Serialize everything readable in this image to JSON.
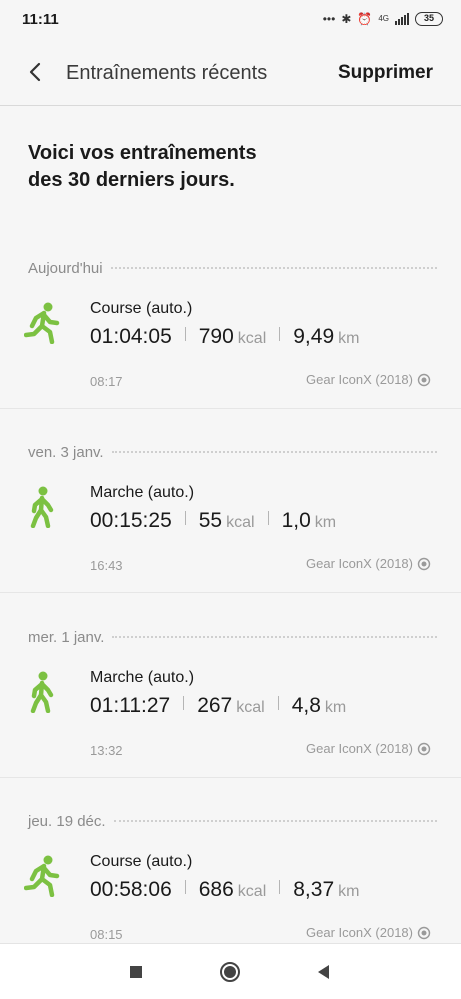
{
  "status": {
    "time": "11:11",
    "net": "4G",
    "battery": "35"
  },
  "header": {
    "title": "Entraînements récents",
    "action": "Supprimer"
  },
  "intro": "Voici vos entraînements\ndes 30 derniers jours.",
  "days": [
    {
      "label": "Aujourd'hui",
      "workout": {
        "type": "run",
        "name": "Course (auto.)",
        "duration": "01:04:05",
        "kcal": "790",
        "kcal_unit": "kcal",
        "distance": "9,49",
        "dist_unit": "km",
        "start": "08:17",
        "device": "Gear IconX (2018)"
      }
    },
    {
      "label": "ven. 3 janv.",
      "workout": {
        "type": "walk",
        "name": "Marche (auto.)",
        "duration": "00:15:25",
        "kcal": "55",
        "kcal_unit": "kcal",
        "distance": "1,0",
        "dist_unit": "km",
        "start": "16:43",
        "device": "Gear IconX (2018)"
      }
    },
    {
      "label": "mer. 1 janv.",
      "workout": {
        "type": "walk",
        "name": "Marche (auto.)",
        "duration": "01:11:27",
        "kcal": "267",
        "kcal_unit": "kcal",
        "distance": "4,8",
        "dist_unit": "km",
        "start": "13:32",
        "device": "Gear IconX (2018)"
      }
    },
    {
      "label": "jeu. 19 déc.",
      "workout": {
        "type": "run",
        "name": "Course (auto.)",
        "duration": "00:58:06",
        "kcal": "686",
        "kcal_unit": "kcal",
        "distance": "8,37",
        "dist_unit": "km",
        "start": "08:15",
        "device": "Gear IconX (2018)"
      }
    }
  ],
  "colors": {
    "accent_green": "#7cc142",
    "background": "#f6f6f6"
  },
  "icons": {
    "run": "running-person-icon",
    "walk": "walking-person-icon",
    "device": "earbud-icon"
  }
}
